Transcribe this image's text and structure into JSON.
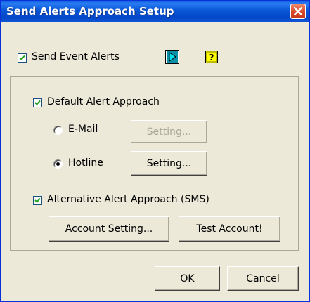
{
  "window": {
    "title": "Send Alerts Approach Setup",
    "close_icon": "close-x-icon"
  },
  "top": {
    "send_event_alerts": {
      "label": "Send Event Alerts",
      "checked": true
    },
    "play_icon": "play-arrow-icon",
    "help_icon": "help-question-icon"
  },
  "group": {
    "default_alert": {
      "label": "Default Alert Approach",
      "checked": true
    },
    "email": {
      "label": "E-Mail",
      "selected": false,
      "setting_label": "Setting...",
      "setting_enabled": false
    },
    "hotline": {
      "label": "Hotline",
      "selected": true,
      "setting_label": "Setting...",
      "setting_enabled": true
    },
    "alternative": {
      "label": "Alternative Alert Approach (SMS)",
      "checked": true
    },
    "account_setting_label": "Account Setting...",
    "test_account_label": "Test Account!"
  },
  "footer": {
    "ok_label": "OK",
    "cancel_label": "Cancel"
  },
  "colors": {
    "titlebar": "#0a57d6",
    "dialog_bg": "#ece9d8",
    "close_red": "#d8462a",
    "help_yellow": "#ffff00",
    "play_cyan": "#00c8e0"
  }
}
